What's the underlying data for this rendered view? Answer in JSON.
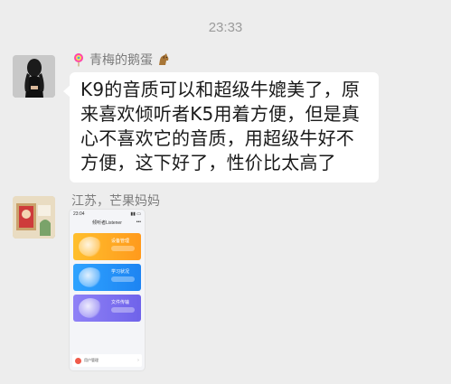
{
  "timestamp": "23:33",
  "messages": [
    {
      "sender": "青梅的鹅蛋",
      "text": "K9的音质可以和超级牛媲美了，原来喜欢倾听者K5用着方便，但是真心不喜欢它的音质，用超级牛好不方便，这下好了，性价比太高了"
    },
    {
      "sender": "江苏，芒果妈妈",
      "screenshot": {
        "status_time": "23:04",
        "title": "倾听者Listener",
        "cards": [
          {
            "label": "设备管理",
            "color": "#ffa91f"
          },
          {
            "label": "学习状况",
            "color": "#2596f8"
          },
          {
            "label": "文件传输",
            "color": "#7e72f0"
          }
        ],
        "bottom_label": "用户管理"
      }
    }
  ]
}
